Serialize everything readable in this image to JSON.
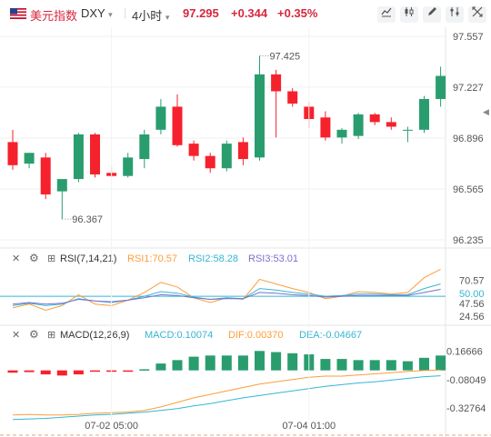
{
  "header": {
    "instrument": "美元指数",
    "symbol": "DXY",
    "symbol_caret": "▾",
    "timeframe": "4小时",
    "timeframe_caret": "▾",
    "price": "97.295",
    "change": "+0.344",
    "change_pct": "+0.35%",
    "tool_icons": [
      "chart-line-icon",
      "candle-style-icon",
      "draw-pen-icon",
      "indicator-settings-icon",
      "expand-icon"
    ]
  },
  "colors": {
    "up": "#2a9d6f",
    "down": "#f5222d",
    "accent": "#d7263d",
    "rsi1": "#ff9c3a",
    "rsi2": "#35b6d3",
    "rsi3": "#7b6fcf",
    "macd": "#35b6d3",
    "dif": "#ff9c3a",
    "dea": "#35b6d3"
  },
  "chart_data": [
    {
      "type": "candlestick",
      "title": "",
      "y_ticks": [
        "97.557",
        "97.227",
        "96.896",
        "96.565",
        "96.235"
      ],
      "ylim": [
        96.235,
        97.557
      ],
      "x_ticks": [
        {
          "index": 6,
          "label": "07-02 05:00"
        },
        {
          "index": 18,
          "label": "07-04 01:00"
        }
      ],
      "annotations": {
        "high_label": "97.425",
        "low_label": "96.367"
      },
      "candles": [
        {
          "o": 96.87,
          "h": 96.95,
          "l": 96.69,
          "c": 96.72
        },
        {
          "o": 96.73,
          "h": 96.8,
          "l": 96.7,
          "c": 96.8
        },
        {
          "o": 96.77,
          "h": 96.8,
          "l": 96.5,
          "c": 96.53
        },
        {
          "o": 96.55,
          "h": 96.62,
          "l": 96.37,
          "c": 96.63
        },
        {
          "o": 96.63,
          "h": 96.93,
          "l": 96.61,
          "c": 96.92
        },
        {
          "o": 96.92,
          "h": 96.93,
          "l": 96.64,
          "c": 96.66
        },
        {
          "o": 96.67,
          "h": 96.71,
          "l": 96.64,
          "c": 96.65
        },
        {
          "o": 96.65,
          "h": 96.8,
          "l": 96.64,
          "c": 96.77
        },
        {
          "o": 96.76,
          "h": 96.95,
          "l": 96.7,
          "c": 96.92
        },
        {
          "o": 96.95,
          "h": 97.15,
          "l": 96.92,
          "c": 97.1
        },
        {
          "o": 97.1,
          "h": 97.18,
          "l": 96.84,
          "c": 96.85
        },
        {
          "o": 96.86,
          "h": 96.88,
          "l": 96.75,
          "c": 96.78
        },
        {
          "o": 96.78,
          "h": 96.8,
          "l": 96.67,
          "c": 96.7
        },
        {
          "o": 96.7,
          "h": 96.88,
          "l": 96.68,
          "c": 96.86
        },
        {
          "o": 96.87,
          "h": 96.9,
          "l": 96.72,
          "c": 96.76
        },
        {
          "o": 96.77,
          "h": 97.43,
          "l": 96.75,
          "c": 97.31
        },
        {
          "o": 97.31,
          "h": 97.34,
          "l": 96.9,
          "c": 97.2
        },
        {
          "o": 97.2,
          "h": 97.22,
          "l": 97.1,
          "c": 97.12
        },
        {
          "o": 97.1,
          "h": 97.13,
          "l": 96.96,
          "c": 97.02
        },
        {
          "o": 97.03,
          "h": 97.07,
          "l": 96.88,
          "c": 96.9
        },
        {
          "o": 96.9,
          "h": 96.96,
          "l": 96.86,
          "c": 96.95
        },
        {
          "o": 96.91,
          "h": 97.06,
          "l": 96.89,
          "c": 97.05
        },
        {
          "o": 97.05,
          "h": 97.06,
          "l": 96.98,
          "c": 97.0
        },
        {
          "o": 97.0,
          "h": 97.03,
          "l": 96.95,
          "c": 96.97
        },
        {
          "o": 96.95,
          "h": 96.97,
          "l": 96.87,
          "c": 96.95
        },
        {
          "o": 96.95,
          "h": 97.17,
          "l": 96.93,
          "c": 97.15
        },
        {
          "o": 97.15,
          "h": 97.36,
          "l": 97.1,
          "c": 97.3
        }
      ]
    },
    {
      "type": "line",
      "title": "RSI(7,14,21)",
      "settings_icon": "settings-icon",
      "close_icon": "close-icon",
      "add_icon": "add-indicator-icon",
      "legend": [
        "RSI1:70.57",
        "RSI2:58.28",
        "RSI3:53.01"
      ],
      "y_ticks": [
        "70.57",
        "50.00",
        "47.56",
        "24.56"
      ],
      "ylim": [
        15,
        90
      ],
      "reference_line": 50,
      "series": [
        {
          "name": "RSI1",
          "values": [
            35,
            40,
            32,
            38,
            52,
            40,
            38,
            45,
            55,
            68,
            62,
            48,
            42,
            48,
            46,
            72,
            66,
            60,
            55,
            47,
            50,
            56,
            55,
            53,
            55,
            74,
            85
          ]
        },
        {
          "name": "RSI2",
          "values": [
            38,
            41,
            38,
            40,
            47,
            44,
            42,
            45,
            50,
            56,
            54,
            49,
            46,
            48,
            47,
            60,
            58,
            55,
            53,
            50,
            51,
            53,
            53,
            52,
            52,
            60,
            66
          ]
        },
        {
          "name": "RSI3",
          "values": [
            40,
            42,
            40,
            41,
            46,
            44,
            43,
            45,
            48,
            52,
            51,
            48,
            46,
            47,
            47,
            55,
            54,
            52,
            51,
            49,
            50,
            51,
            51,
            51,
            51,
            55,
            59
          ]
        }
      ]
    },
    {
      "type": "bar+line",
      "title": "MACD(12,26,9)",
      "settings_icon": "settings-icon",
      "close_icon": "close-icon",
      "add_icon": "add-indicator-icon",
      "legend": [
        "MACD:0.10074",
        "DIF:0.00370",
        "DEA:-0.04667"
      ],
      "y_ticks": [
        "0.16666",
        "-0.08049",
        "-0.32764"
      ],
      "ylim": [
        -0.4,
        0.22
      ],
      "histogram": [
        -0.02,
        -0.015,
        -0.035,
        -0.045,
        -0.035,
        -0.01,
        -0.005,
        0.0,
        0.01,
        0.06,
        0.09,
        0.12,
        0.13,
        0.13,
        0.13,
        0.17,
        0.16,
        0.15,
        0.14,
        0.1,
        0.1,
        0.09,
        0.09,
        0.09,
        0.08,
        0.11,
        0.13
      ],
      "series": [
        {
          "name": "DIF",
          "values": [
            -0.39,
            -0.385,
            -0.39,
            -0.39,
            -0.385,
            -0.375,
            -0.37,
            -0.365,
            -0.35,
            -0.32,
            -0.28,
            -0.24,
            -0.21,
            -0.18,
            -0.15,
            -0.12,
            -0.1,
            -0.08,
            -0.06,
            -0.05,
            -0.05,
            -0.04,
            -0.03,
            -0.02,
            -0.01,
            0.0,
            0.004
          ]
        },
        {
          "name": "DEA",
          "values": [
            -0.43,
            -0.425,
            -0.42,
            -0.41,
            -0.4,
            -0.39,
            -0.385,
            -0.375,
            -0.365,
            -0.35,
            -0.335,
            -0.31,
            -0.29,
            -0.265,
            -0.24,
            -0.22,
            -0.2,
            -0.18,
            -0.16,
            -0.14,
            -0.125,
            -0.11,
            -0.1,
            -0.085,
            -0.07,
            -0.055,
            -0.047
          ]
        }
      ]
    }
  ]
}
